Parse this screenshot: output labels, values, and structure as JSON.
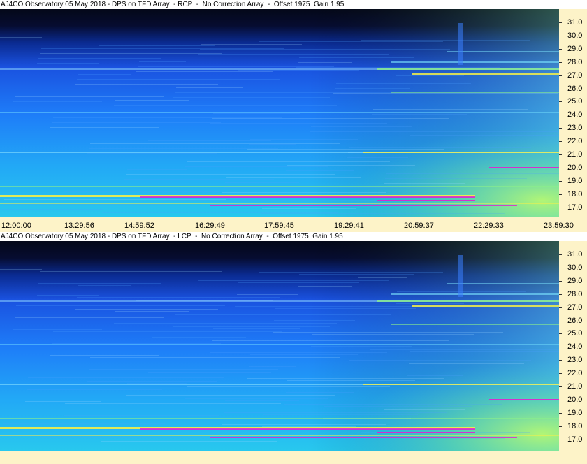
{
  "panels": [
    {
      "title": "AJ4CO Observatory 05 May 2018 - DPS on TFD Array  - RCP  -  No Correction Array  -  Offset 1975  Gain 1.95",
      "y_ticks": [
        "31.0",
        "30.0",
        "29.0",
        "28.0",
        "27.0",
        "26.0",
        "25.0",
        "24.0",
        "23.0",
        "22.0",
        "21.0",
        "20.0",
        "19.0",
        "18.0",
        "17.0"
      ],
      "x_ticks": [
        "12:00:00",
        "13:29:56",
        "14:59:52",
        "16:29:49",
        "17:59:45",
        "19:29:41",
        "20:59:37",
        "22:29:33",
        "23:59:30"
      ]
    },
    {
      "title": "AJ4CO Observatory 05 May 2018 - DPS on TFD Array  - LCP  -  No Correction Array  -  Offset 1975  Gain 1.95",
      "y_ticks": [
        "31.0",
        "30.0",
        "29.0",
        "28.0",
        "27.0",
        "26.0",
        "25.0",
        "24.0",
        "23.0",
        "22.0",
        "21.0",
        "20.0",
        "19.0",
        "18.0",
        "17.0"
      ],
      "x_ticks": []
    }
  ],
  "colors": {
    "background": "#fdf3c8",
    "spectrogram_dark": "#050a2a",
    "spectrogram_blue": "#1e64ff",
    "spectrogram_cyan": "#22b8f0",
    "spectrogram_green": "#8cf08a",
    "interference_yellow": "#f4f048",
    "interference_magenta": "#e020d0"
  }
}
